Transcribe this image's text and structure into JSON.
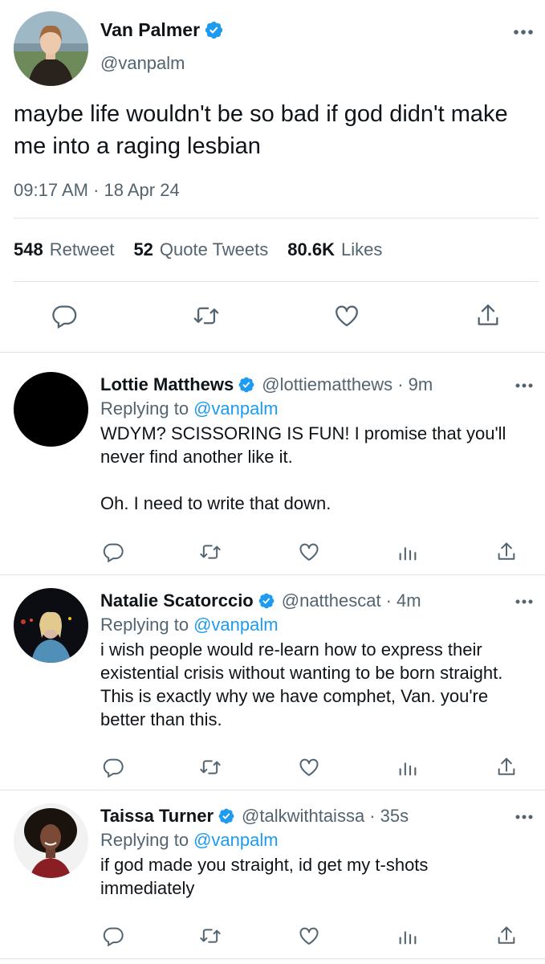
{
  "main_tweet": {
    "name": "Van Palmer",
    "handle": "@vanpalm",
    "text": "maybe life wouldn't be so bad if god didn't make me into a raging lesbian",
    "timestamp": "09:17 AM · 18 Apr 24",
    "stats": [
      {
        "count": "548",
        "label": "Retweet"
      },
      {
        "count": "52",
        "label": "Quote Tweets"
      },
      {
        "count": "80.6K",
        "label": "Likes"
      }
    ],
    "actions": [
      "reply-icon",
      "retweet-icon",
      "like-icon",
      "share-icon"
    ]
  },
  "replies": [
    {
      "name": "Lottie Matthews",
      "handle": "@lottiematthews",
      "time": "· 9m",
      "replying_label": "Replying to",
      "replying_to": "@vanpalm",
      "paragraphs": [
        "WDYM? SCISSORING IS FUN! I promise that you'll never find another like it.",
        "Oh. I need to write that down."
      ]
    },
    {
      "name": "Natalie Scatorccio",
      "handle": "@natthescat",
      "time": "· 4m",
      "replying_label": "Replying to",
      "replying_to": "@vanpalm",
      "paragraphs": [
        "i wish people would re-learn how to express their existential crisis without wanting to be born straight. This is exactly why we have comphet, Van. you're better than this."
      ]
    },
    {
      "name": "Taissa Turner",
      "handle": "@talkwithtaissa",
      "time": "· 35s",
      "replying_label": "Replying to",
      "replying_to": "@vanpalm",
      "paragraphs": [
        "if god made you straight, id get my t-shots immediately"
      ]
    }
  ],
  "colors": {
    "accent": "#1d9bf0",
    "text": "#0f1419",
    "secondary": "#536471",
    "divider": "#dde3e8"
  }
}
